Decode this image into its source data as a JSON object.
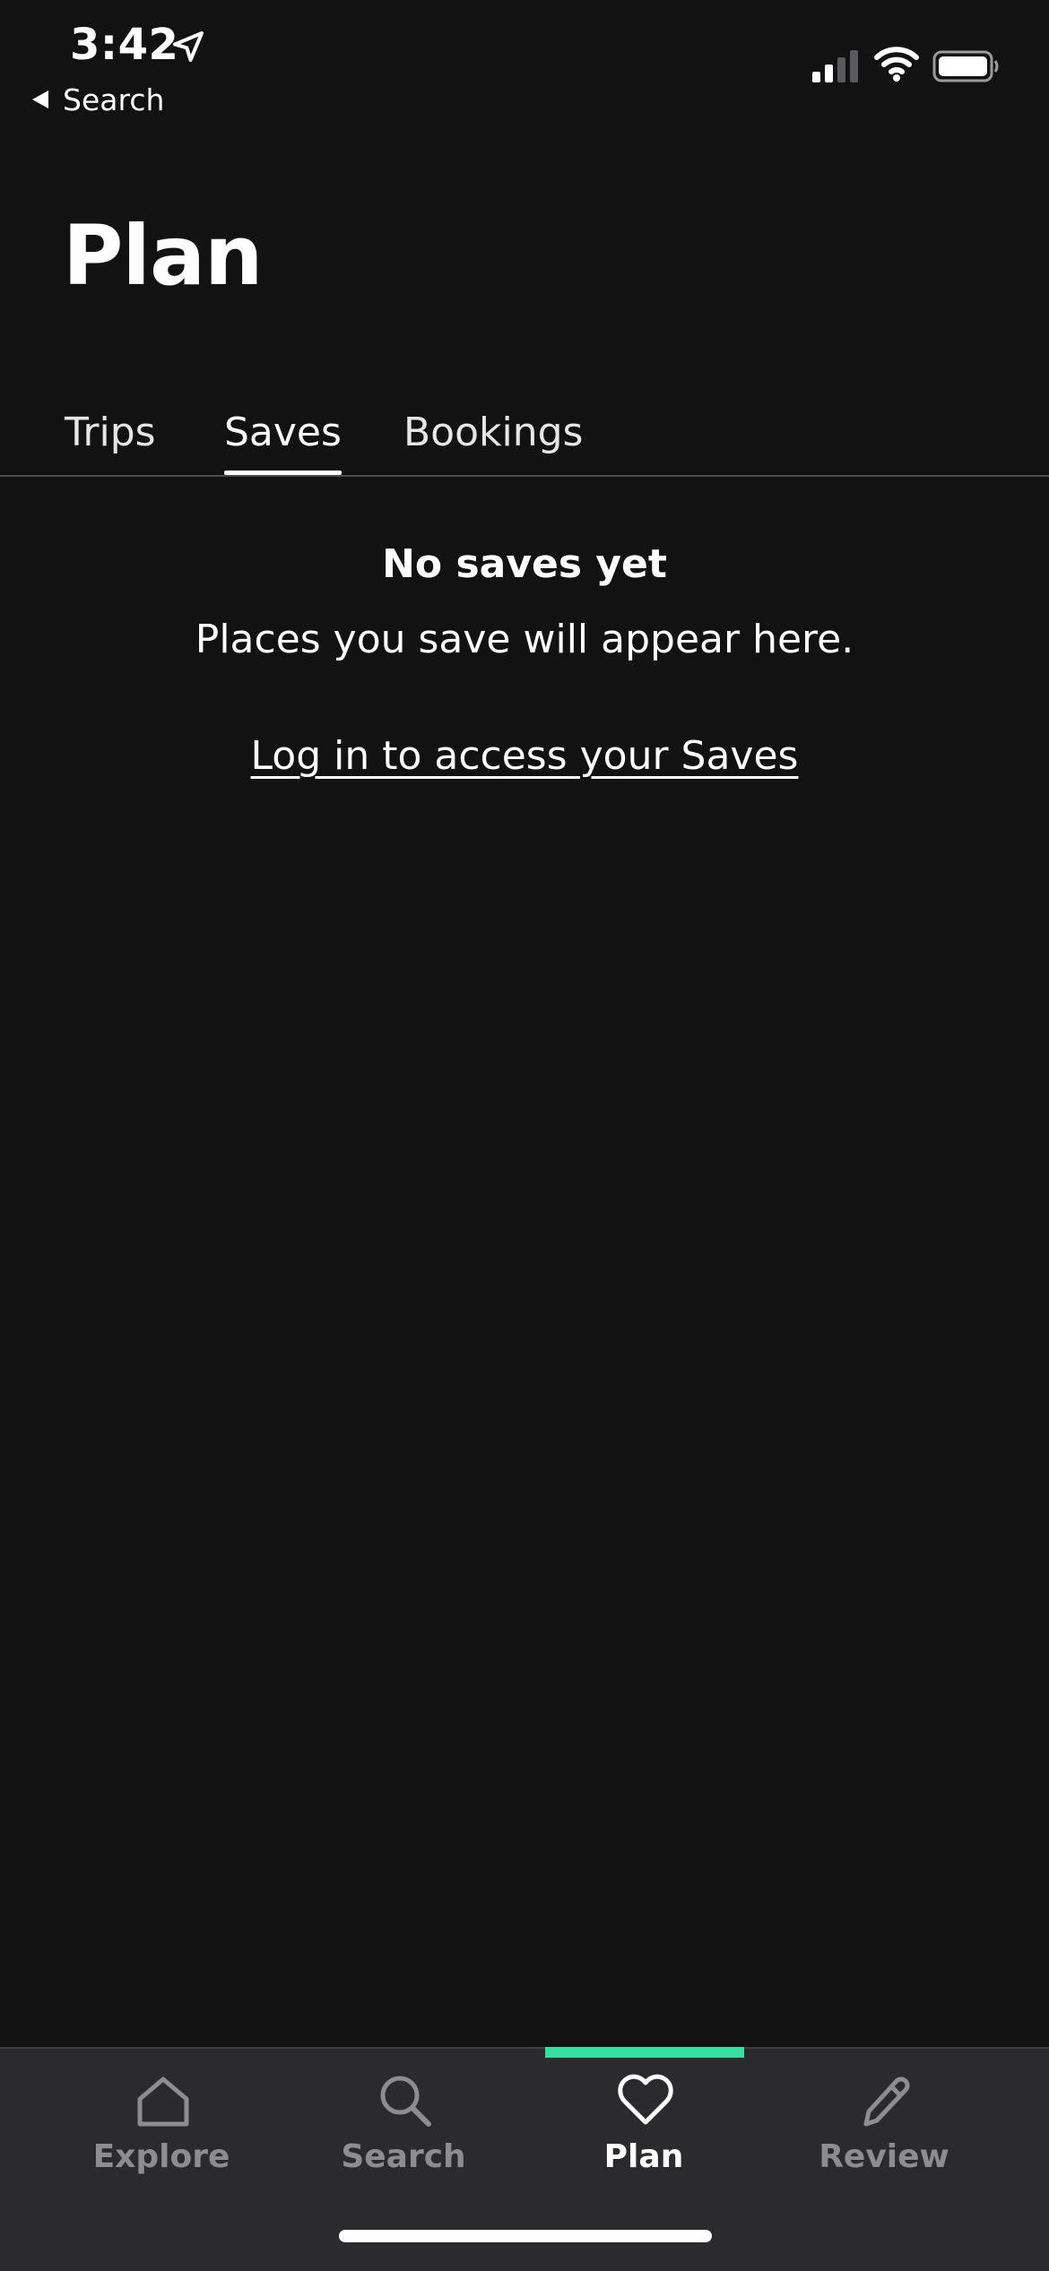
{
  "status_bar": {
    "time": "3:42",
    "back_label": "Search",
    "icons": [
      "location-arrow-icon",
      "signal-icon",
      "wifi-icon",
      "battery-icon"
    ]
  },
  "page": {
    "title": "Plan"
  },
  "tabs": [
    {
      "label": "Trips",
      "active": false
    },
    {
      "label": "Saves",
      "active": true
    },
    {
      "label": "Bookings",
      "active": false
    }
  ],
  "empty_state": {
    "title": "No saves yet",
    "subtitle": "Places you save will appear here.",
    "login_link": "Log in to access your Saves"
  },
  "bottom_nav": {
    "items": [
      {
        "label": "Explore",
        "icon": "home-icon",
        "active": false
      },
      {
        "label": "Search",
        "icon": "search-icon",
        "active": false
      },
      {
        "label": "Plan",
        "icon": "heart-icon",
        "active": true
      },
      {
        "label": "Review",
        "icon": "pencil-icon",
        "active": false
      }
    ]
  },
  "colors": {
    "background": "#121213",
    "nav_background": "#2b2b2d",
    "accent": "#34e0a1",
    "inactive": "#8d8d90"
  }
}
